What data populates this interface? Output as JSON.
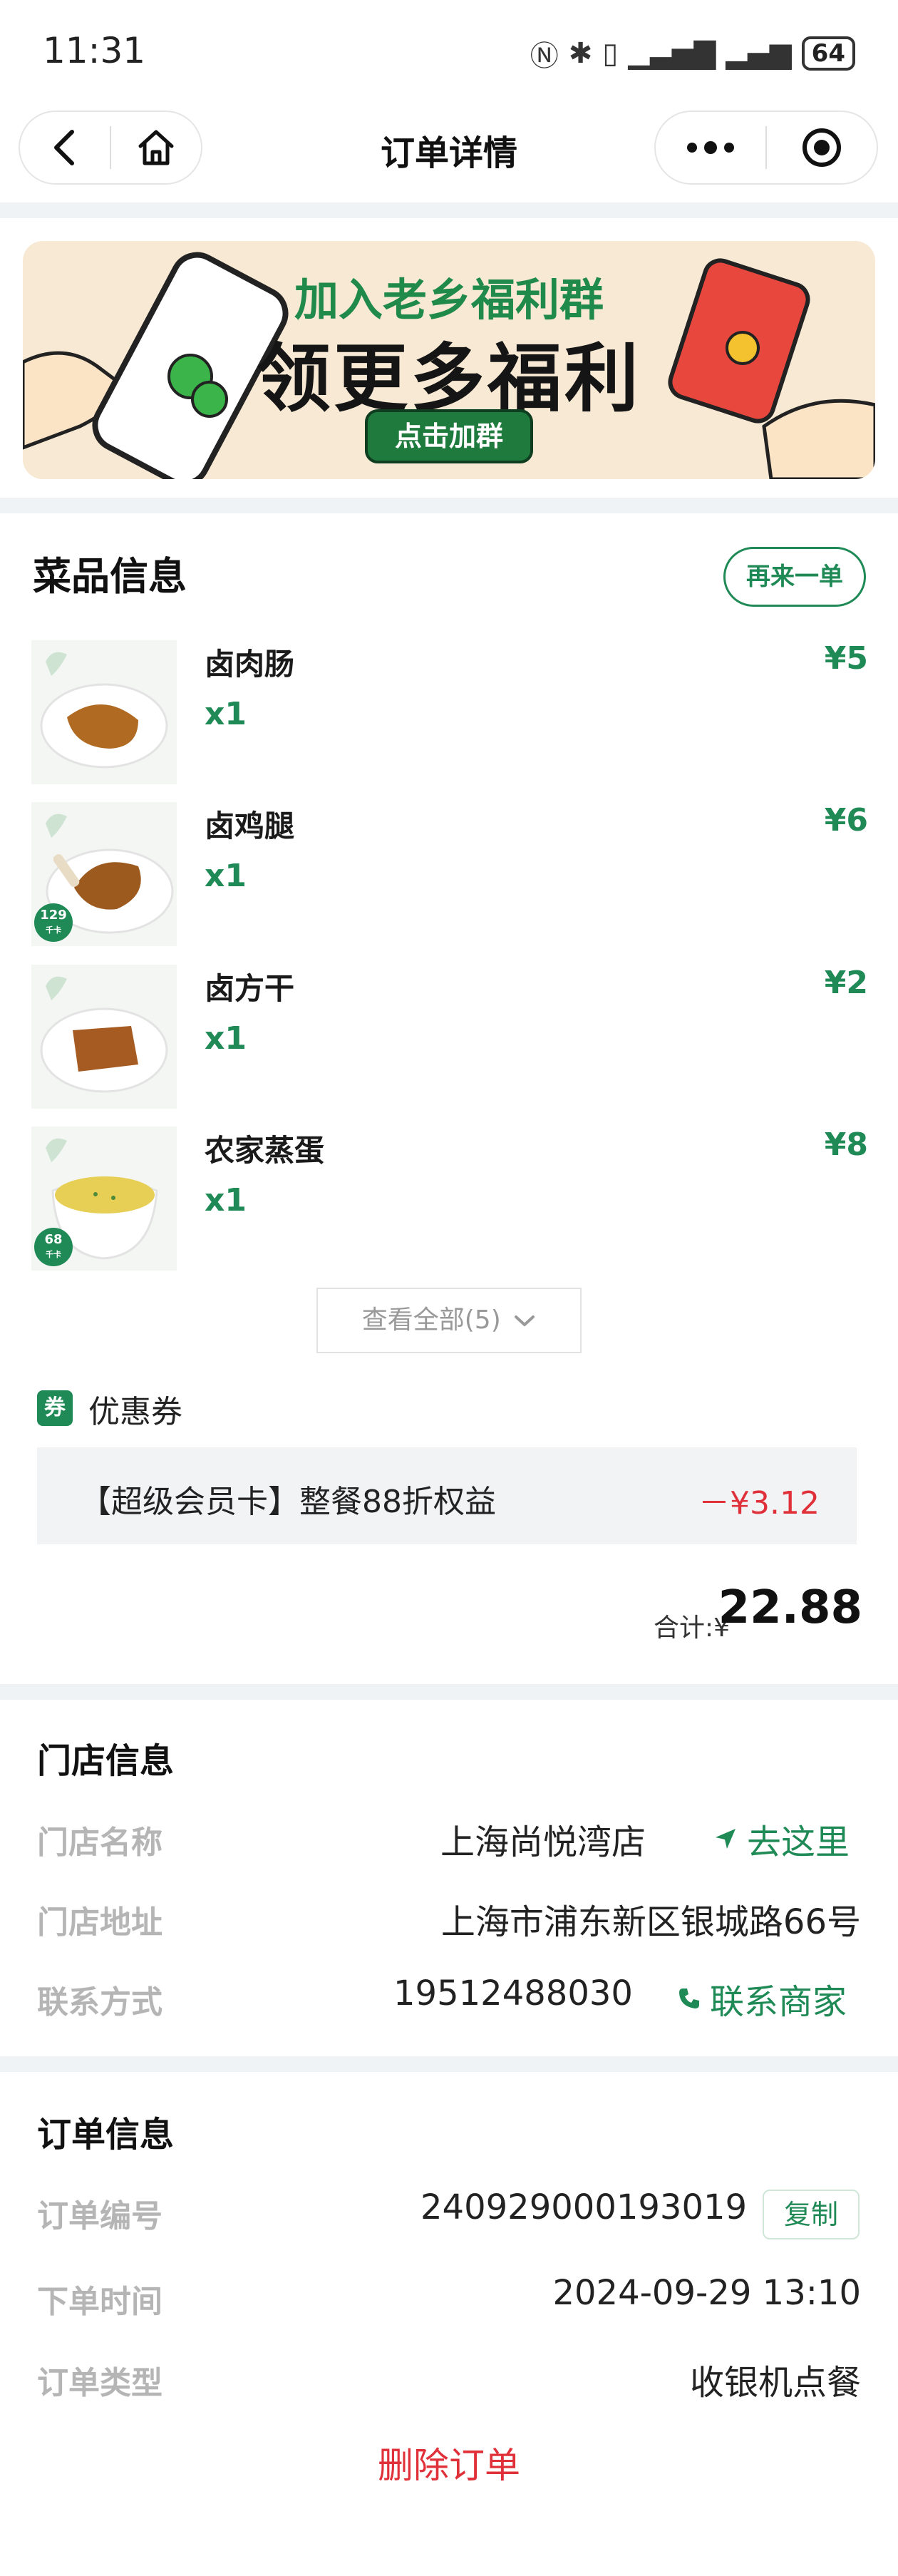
{
  "status_bar": {
    "time": "11:31",
    "battery": "64"
  },
  "nav": {
    "title": "订单详情"
  },
  "banner": {
    "line1": "加入老乡福利群",
    "line2": "领更多福利",
    "button": "点击加群"
  },
  "dishes_section": {
    "title": "菜品信息",
    "reorder_label": "再来一单",
    "items": [
      {
        "name": "卤肉肠",
        "qty": "x1",
        "price": "¥5",
        "kcal": ""
      },
      {
        "name": "卤鸡腿",
        "qty": "x1",
        "price": "¥6",
        "kcal": "129"
      },
      {
        "name": "卤方干",
        "qty": "x1",
        "price": "¥2",
        "kcal": ""
      },
      {
        "name": "农家蒸蛋",
        "qty": "x1",
        "price": "¥8",
        "kcal": "68"
      }
    ],
    "kcal_unit": "千卡",
    "view_all": "查看全部(5)"
  },
  "coupon": {
    "icon_text": "券",
    "label": "优惠券",
    "text": "【超级会员卡】整餐88折权益",
    "value": "－¥3.12"
  },
  "total": {
    "label": "合计:¥",
    "value": "22.88"
  },
  "store": {
    "title": "门店信息",
    "name_label": "门店名称",
    "name": "上海尚悦湾店",
    "navigate": "去这里",
    "address_label": "门店地址",
    "address": "上海市浦东新区银城路66号",
    "contact_label": "联系方式",
    "phone": "19512488030",
    "contact_merchant": "联系商家"
  },
  "order": {
    "title": "订单信息",
    "number_label": "订单编号",
    "number": "240929000193019",
    "copy": "复制",
    "time_label": "下单时间",
    "time": "2024-09-29 13:10",
    "type_label": "订单类型",
    "type": "收银机点餐",
    "delete": "删除订单"
  },
  "colors": {
    "brand_green": "#1f8a56",
    "danger_red": "#e0303a",
    "label_gray": "#b5b5b5"
  }
}
